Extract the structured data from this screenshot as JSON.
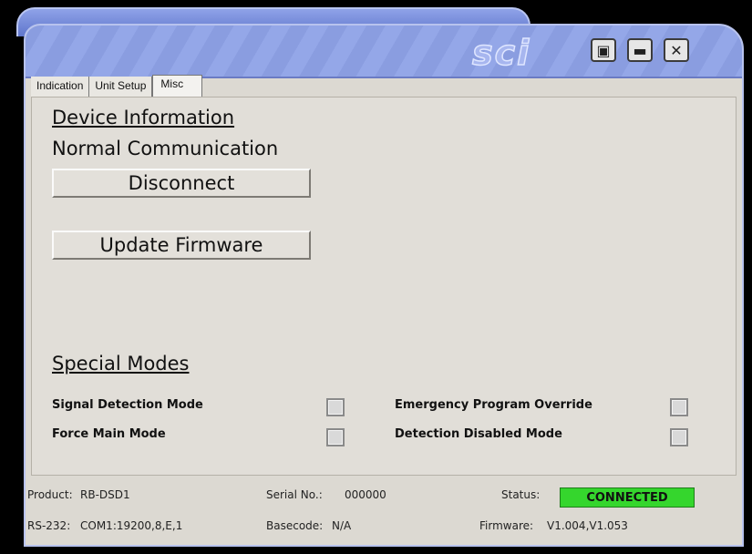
{
  "window": {
    "logo": "sci"
  },
  "controls": {
    "restore": "▣",
    "minimize": "▬",
    "close": "✕"
  },
  "tabs": [
    {
      "label": "Indication"
    },
    {
      "label": "Unit Setup"
    },
    {
      "label": "Misc"
    }
  ],
  "device": {
    "heading": "Device Information",
    "status_text": "Normal Communication",
    "disconnect_label": "Disconnect",
    "update_label": "Update Firmware"
  },
  "special": {
    "heading": "Special Modes",
    "modes": [
      {
        "label": "Signal Detection Mode",
        "checked": false
      },
      {
        "label": "Emergency Program Override",
        "checked": false
      },
      {
        "label": "Force Main Mode",
        "checked": false
      },
      {
        "label": "Detection Disabled Mode",
        "checked": false
      }
    ]
  },
  "statusbar": {
    "product_label": "Product:",
    "product_value": "RB-DSD1",
    "serial_label": "Serial No.:",
    "serial_value": "000000",
    "status_label": "Status:",
    "status_value": "CONNECTED",
    "rs232_label": "RS-232:",
    "rs232_value": "COM1:19200,8,E,1",
    "basecode_label": "Basecode:",
    "basecode_value": "N/A",
    "firmware_label": "Firmware:",
    "firmware_value": "V1.004,V1.053"
  },
  "colors": {
    "frame": "#7f93de",
    "panel": "#dcd9d2",
    "connected": "#35d62d"
  }
}
